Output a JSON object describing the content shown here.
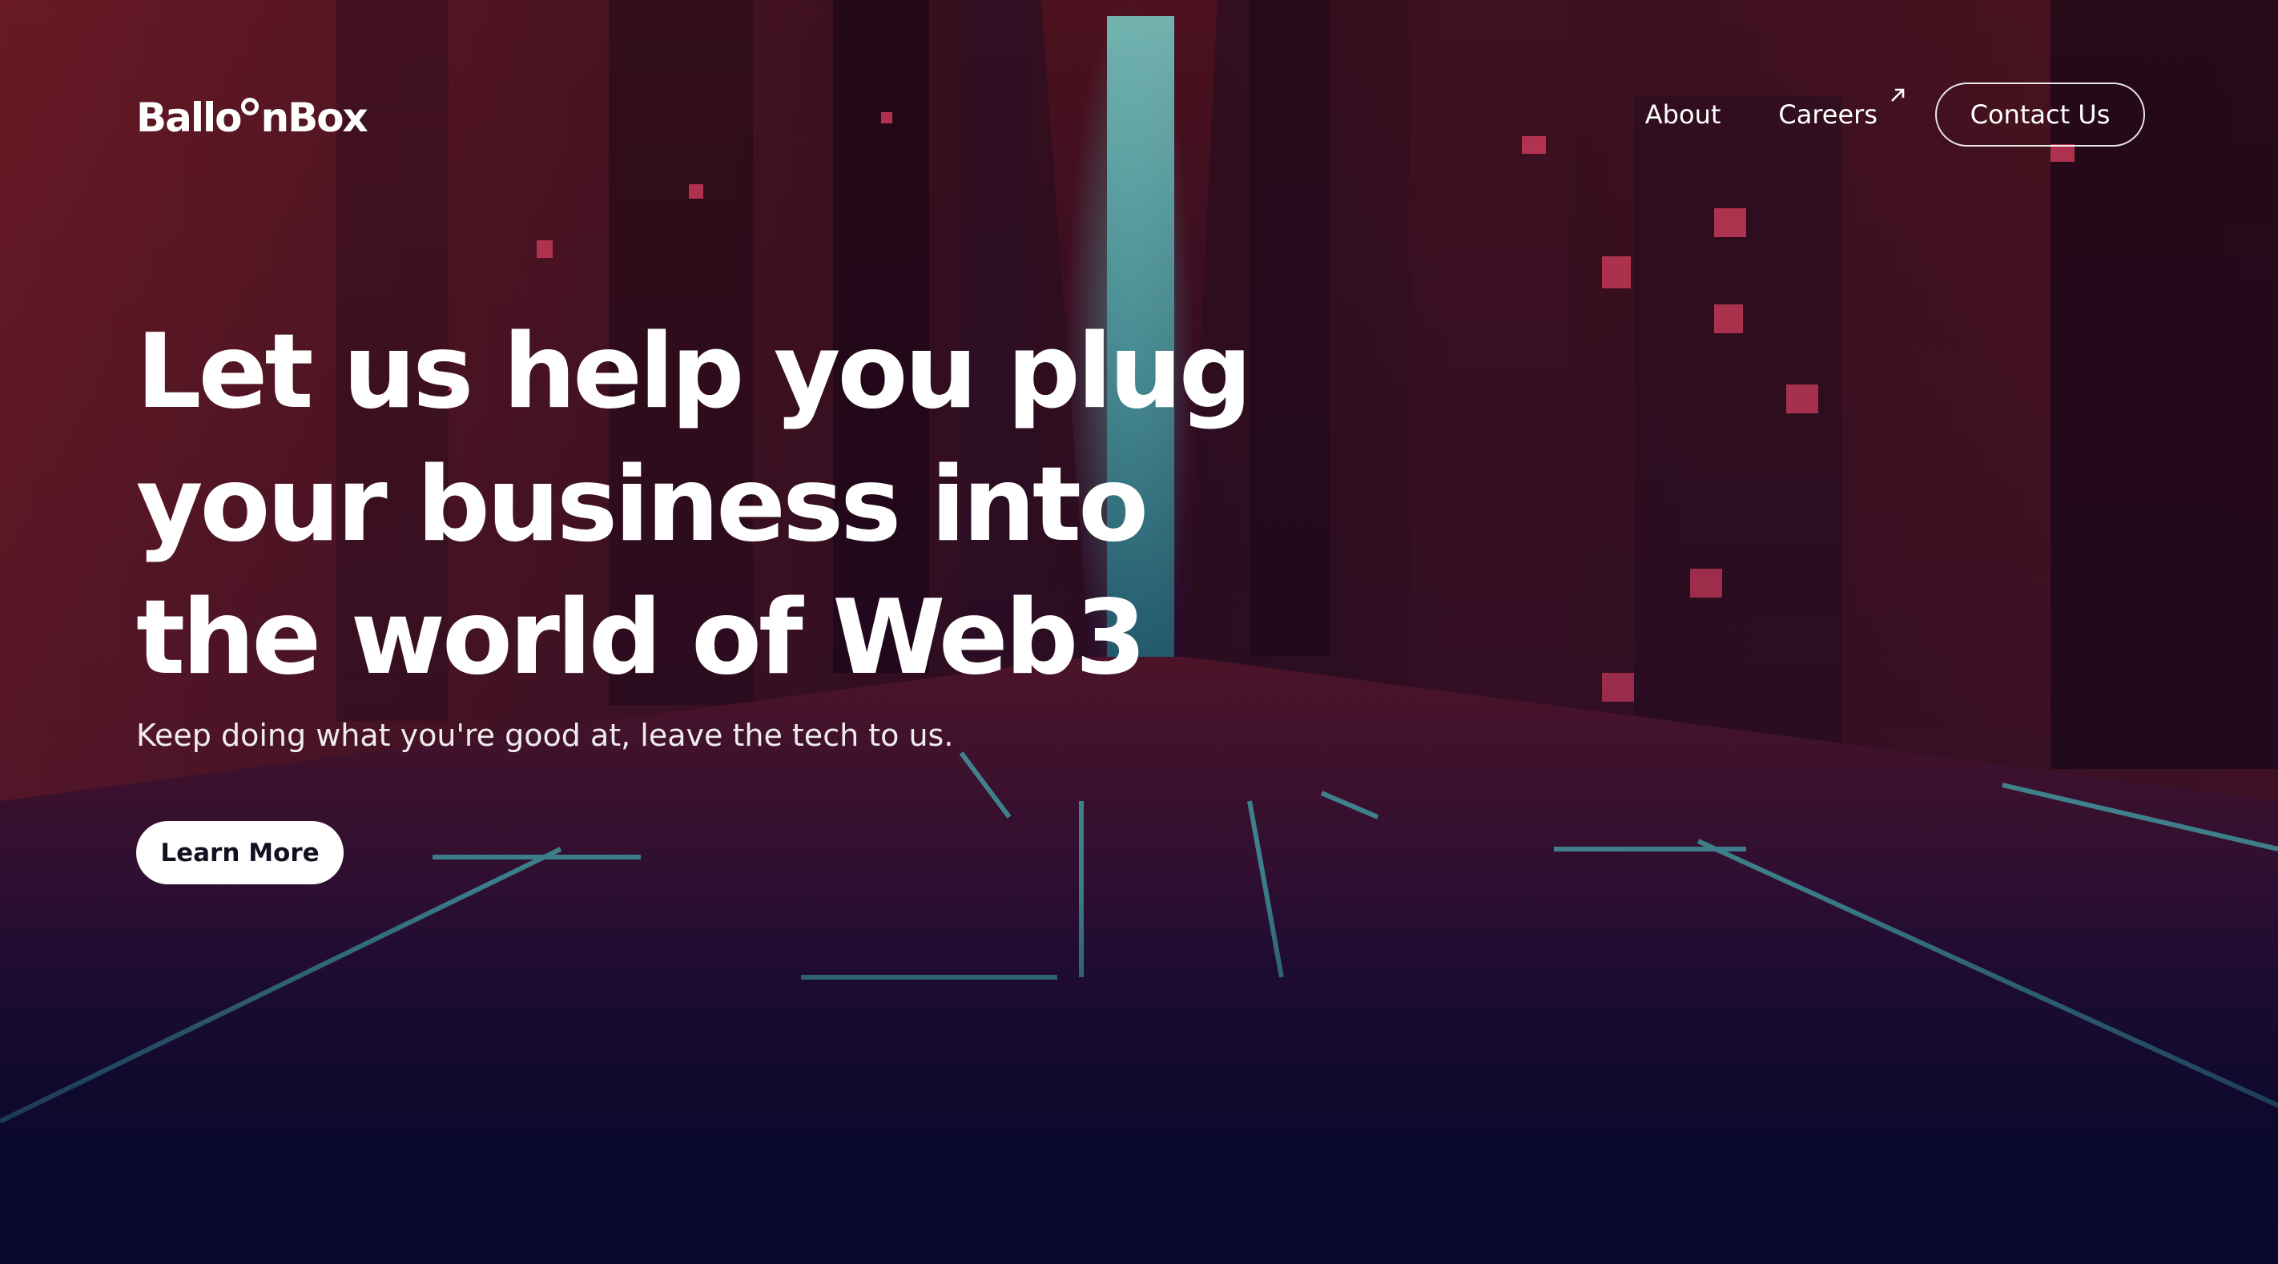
{
  "header": {
    "logo_left": "Ballo",
    "logo_right": "nBox",
    "nav": {
      "about_label": "About",
      "careers_label": "Careers",
      "contact_label": "Contact Us"
    }
  },
  "hero": {
    "title_lines": [
      "Let us help you plug",
      "your business into",
      "the world of Web3"
    ],
    "subtitle": "Keep doing what you're good at, leave the tech to us.",
    "cta_label": "Learn More"
  },
  "icons": {
    "careers_external": "external-link-arrow-icon"
  },
  "colors": {
    "background_deep": "#0a0a2a",
    "city_red": "#c0203a",
    "neon_cyan": "#5ee8e0",
    "text_white": "#ffffff",
    "cta_text": "#111122"
  }
}
